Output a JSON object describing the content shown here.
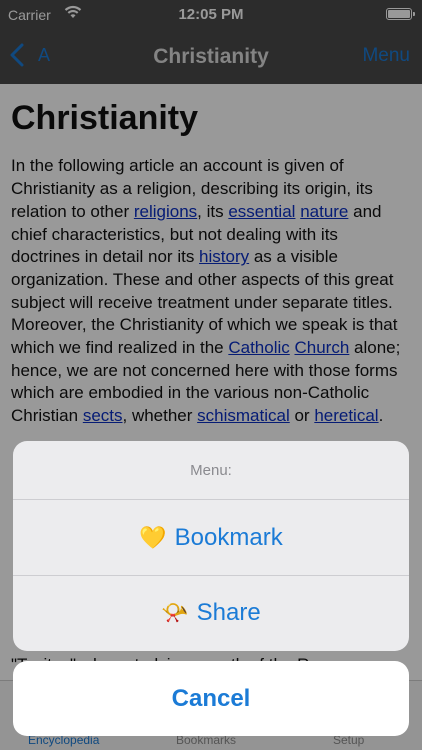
{
  "status_bar": {
    "carrier": "Carrier",
    "time": "12:05 PM"
  },
  "nav": {
    "back_label": "A",
    "title": "Christianity",
    "menu_label": "Menu"
  },
  "article": {
    "heading": "Christianity",
    "p1": {
      "t1": "In the following article an account is given of Christianity as a religion, describing its origin, its relation to other ",
      "l_religions": "religions",
      "t2": ", its ",
      "l_essential": "essential",
      "t3": " ",
      "l_nature": "nature",
      "t4": " and chief characteristics, but not dealing with its doctrines in detail nor its ",
      "l_history": "history",
      "t5": " as a visible organization. These and other aspects of this great subject will receive treatment under separate titles. Moreover, the Christianity of which we speak is that which we find realized in the ",
      "l_catholic": "Catholic",
      "t6": " ",
      "l_church": "Church",
      "t7": " alone; hence, we are not concerned here with those forms which are embodied in the various non-Catholic Christian ",
      "l_sects": "sects",
      "t8": ", whether ",
      "l_schismatical": "schismatical",
      "t9": " or ",
      "l_heretical": "heretical",
      "t10": "."
    },
    "p2_tail": "\"Tacitus\" when studying growth of the Roman"
  },
  "tabs": [
    {
      "label": "Encyclopedia",
      "active": true
    },
    {
      "label": "Bookmarks",
      "active": false
    },
    {
      "label": "Setup",
      "active": false
    }
  ],
  "action_sheet": {
    "title": "Menu:",
    "bookmark": {
      "emoji": "💛",
      "label": "Bookmark"
    },
    "share": {
      "emoji": "📯",
      "label": "Share"
    },
    "cancel_label": "Cancel"
  },
  "colors": {
    "accent": "#1b7bd6",
    "nav_bg": "#4a4a4a",
    "link": "#0b2fc4"
  }
}
